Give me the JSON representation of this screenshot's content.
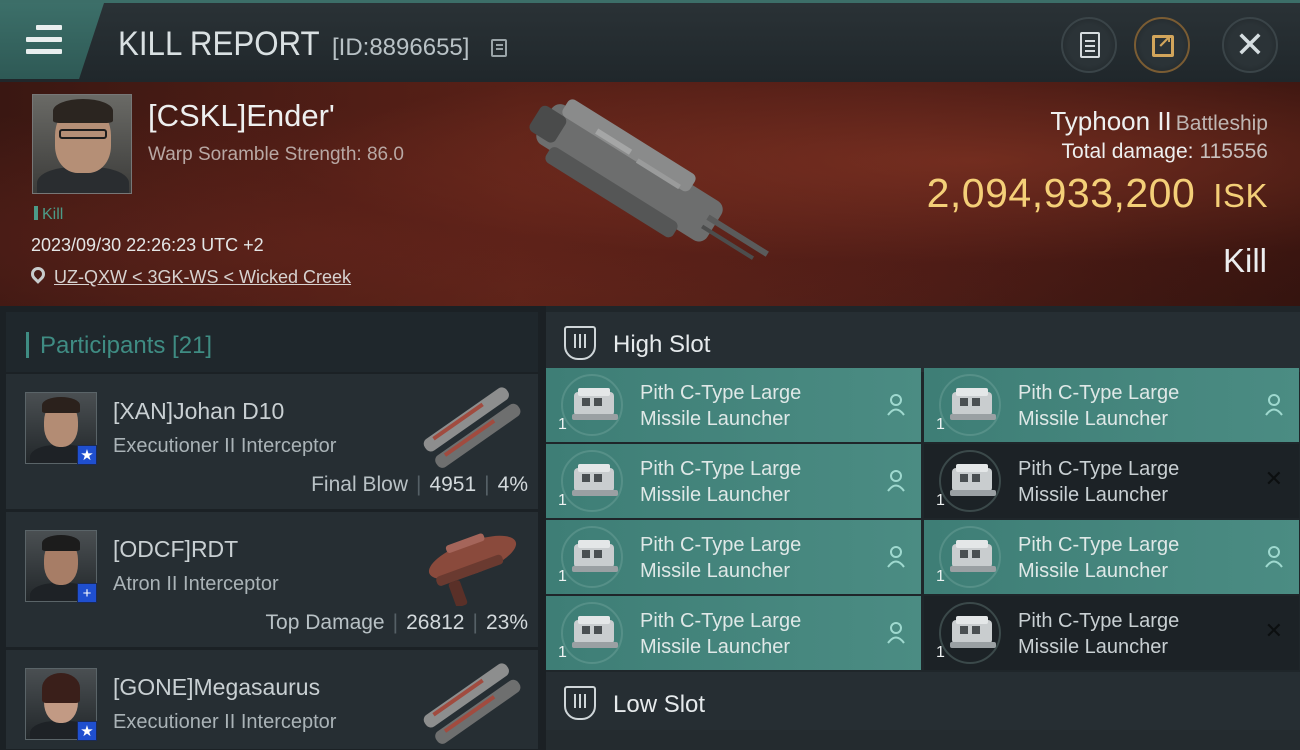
{
  "header": {
    "title": "KILL REPORT",
    "report_id": "[ID:8896655]"
  },
  "victim": {
    "name": "[CSKL]Ender'",
    "scramble": "Warp Soramble Strength: 86.0",
    "kill_tag": "Kill",
    "timestamp": "2023/09/30 22:26:23 UTC +2",
    "location": "UZ-QXW < 3GK-WS < Wicked Creek",
    "ship": "Typhoon II",
    "ship_class": "Battleship",
    "damage_label": "Total damage:",
    "damage_value": "115556",
    "isk_value": "2,094,933,200",
    "isk_unit": "ISK",
    "result": "Kill"
  },
  "participants": {
    "label": "Participants [21]",
    "items": [
      {
        "name": "[XAN]Johan D10",
        "ship": "Executioner II Interceptor",
        "role": "Final Blow",
        "damage": "4951",
        "percent": "4%",
        "badge": "★"
      },
      {
        "name": "[ODCF]RDT",
        "ship": "Atron II Interceptor",
        "role": "Top Damage",
        "damage": "26812",
        "percent": "23%",
        "badge": "+"
      },
      {
        "name": "[GONE]Megasaurus",
        "ship": "Executioner II Interceptor",
        "badge": "★"
      }
    ]
  },
  "high_slot": {
    "title": "High Slot",
    "modules": [
      {
        "line1": "Pith C-Type Large",
        "line2": "Missile Launcher",
        "qty": "1",
        "state": "active"
      },
      {
        "line1": "Pith C-Type Large",
        "line2": "Missile Launcher",
        "qty": "1",
        "state": "active"
      },
      {
        "line1": "Pith C-Type Large",
        "line2": "Missile Launcher",
        "qty": "1",
        "state": "active"
      },
      {
        "line1": "Pith C-Type Large",
        "line2": "Missile Launcher",
        "qty": "1",
        "state": "destroyed"
      },
      {
        "line1": "Pith C-Type Large",
        "line2": "Missile Launcher",
        "qty": "1",
        "state": "active"
      },
      {
        "line1": "Pith C-Type Large",
        "line2": "Missile Launcher",
        "qty": "1",
        "state": "active"
      },
      {
        "line1": "Pith C-Type Large",
        "line2": "Missile Launcher",
        "qty": "1",
        "state": "active"
      },
      {
        "line1": "Pith C-Type Large",
        "line2": "Missile Launcher",
        "qty": "1",
        "state": "destroyed"
      }
    ]
  },
  "low_slot": {
    "title": "Low Slot"
  },
  "colors": {
    "accent": "#3f8c83",
    "isk": "#f4cf78",
    "badge": "#1f4fcf"
  },
  "icons": {
    "menu": "menu-icon",
    "copy": "copy-icon",
    "notes": "notes-icon",
    "share": "share-icon",
    "close": "close-icon",
    "location": "location-pin-icon",
    "slot": "high-slot-icon",
    "pilot": "pilot-icon"
  }
}
